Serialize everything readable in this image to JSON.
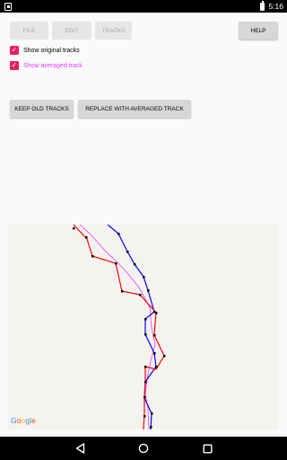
{
  "status_bar": {
    "time": "5:16",
    "icons": [
      "sim-card-icon",
      "battery-icon"
    ]
  },
  "toolbar": {
    "file_label": "File",
    "edit_label": "Edit",
    "tracks_label": "Tracks",
    "help_label": "Help"
  },
  "options": {
    "show_original": {
      "label": "Show original tracks",
      "checked": true
    },
    "show_averaged": {
      "label": "Show averaged track",
      "checked": true
    }
  },
  "actions": {
    "keep_label": "Keep old tracks",
    "replace_label": "Replace with averaged track"
  },
  "map": {
    "logo_text": "Google",
    "colors": {
      "blue_track": "#0000ff",
      "red_track": "#ff0000",
      "averaged_track": "#e040fb",
      "waypoint": "#000000"
    }
  },
  "nav_bar": {
    "icons": [
      "back-icon",
      "home-icon",
      "recents-icon"
    ]
  }
}
